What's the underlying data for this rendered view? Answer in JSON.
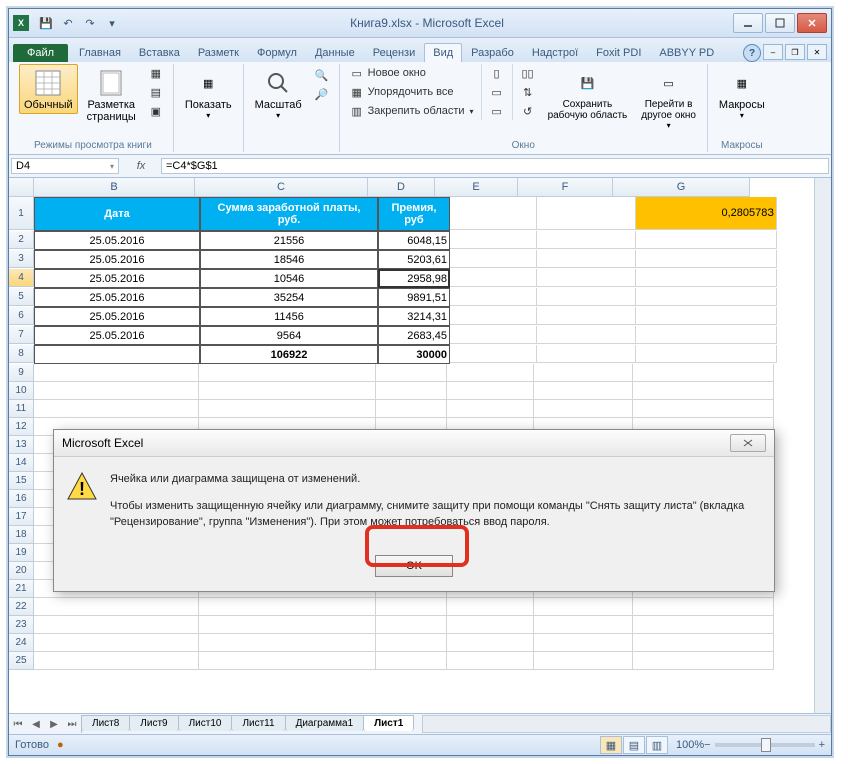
{
  "window": {
    "title": "Книга9.xlsx - Microsoft Excel",
    "qat_save": "💾",
    "qat_undo": "↶",
    "qat_redo": "↷"
  },
  "tabs": {
    "file": "Файл",
    "items": [
      "Главная",
      "Вставка",
      "Разметк",
      "Формул",
      "Данные",
      "Рецензи",
      "Вид",
      "Разрабо",
      "Надстрої",
      "Foxit PDI",
      "ABBYY PD"
    ],
    "active_index": 6
  },
  "ribbon": {
    "normal": "Обычный",
    "page_layout": "Разметка\nстраницы",
    "group_views": "Режимы просмотра книги",
    "show": "Показать",
    "zoom": "Масштаб",
    "new_window": "Новое окно",
    "arrange": "Упорядочить все",
    "freeze": "Закрепить области",
    "group_window": "Окно",
    "save_workspace": "Сохранить\nрабочую область",
    "switch_window": "Перейти в\nдругое окно",
    "macros": "Макросы",
    "group_macros": "Макросы"
  },
  "namebox": "D4",
  "formula": "=C4*$G$1",
  "columns": [
    "B",
    "C",
    "D",
    "E",
    "F",
    "G"
  ],
  "headers": {
    "b": "Дата",
    "c": "Сумма заработной платы,\nруб.",
    "d": "Премия,\nруб"
  },
  "rows": [
    {
      "n": "2",
      "b": "25.05.2016",
      "c": "21556",
      "d": "6048,15"
    },
    {
      "n": "3",
      "b": "25.05.2016",
      "c": "18546",
      "d": "5203,61"
    },
    {
      "n": "4",
      "b": "25.05.2016",
      "c": "10546",
      "d": "2958,98"
    },
    {
      "n": "5",
      "b": "25.05.2016",
      "c": "35254",
      "d": "9891,51"
    },
    {
      "n": "6",
      "b": "25.05.2016",
      "c": "11456",
      "d": "3214,31"
    },
    {
      "n": "7",
      "b": "25.05.2016",
      "c": "9564",
      "d": "2683,45"
    }
  ],
  "totals": {
    "n": "8",
    "c": "106922",
    "d": "30000"
  },
  "g1_value": "0,280578З",
  "empty_rows": [
    "9",
    "10",
    "11",
    "12",
    "13",
    "14",
    "15",
    "16",
    "17",
    "18",
    "19",
    "20",
    "21",
    "22",
    "23",
    "24",
    "25"
  ],
  "sheets": [
    "Лист8",
    "Лист9",
    "Лист10",
    "Лист11",
    "Диаграмма1",
    "Лист1"
  ],
  "active_sheet_index": 5,
  "status": {
    "ready": "Готово",
    "zoom": "100%"
  },
  "dialog": {
    "title": "Microsoft Excel",
    "line1": "Ячейка или диаграмма защищена от изменений.",
    "line2": "Чтобы изменить защищенную ячейку или диаграмму, снимите защиту при помощи команды \"Снять защиту листа\" (вкладка \"Рецензирование\", группа \"Изменения\"). При этом может потребоваться ввод пароля.",
    "ok": "OK"
  }
}
